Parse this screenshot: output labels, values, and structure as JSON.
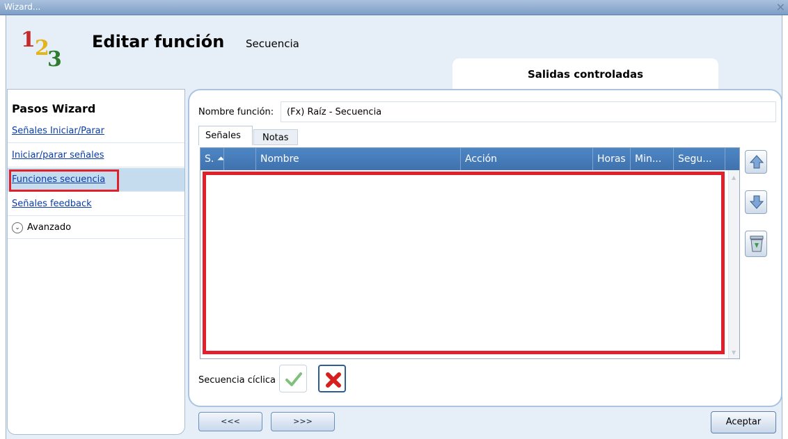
{
  "window": {
    "title": "Wizard...",
    "close_glyph": "✕"
  },
  "logo": {
    "digits": [
      "1",
      "2",
      "3"
    ]
  },
  "header": {
    "title": "Editar función",
    "subtitle": "Secuencia",
    "step_tab": "Salidas controladas"
  },
  "sidebar": {
    "heading": "Pasos Wizard",
    "items": [
      {
        "label": "Señales Iniciar/Parar",
        "selected": false
      },
      {
        "label": "Iniciar/parar señales",
        "selected": false
      },
      {
        "label": "Funciones secuencia",
        "selected": true
      },
      {
        "label": "Señales feedback",
        "selected": false
      }
    ],
    "advanced": {
      "label": "Avanzado",
      "icon": "chevron-down-circle-icon"
    }
  },
  "form": {
    "name_label": "Nombre función:",
    "name_value": "(Fx) Raíz - Secuencia",
    "tabs": [
      "Señales",
      "Notas"
    ],
    "active_tab": "Señales"
  },
  "grid": {
    "columns": [
      "S. ⏶",
      "",
      "Nombre",
      "Acción",
      "Horas",
      "Min...",
      "Segu..."
    ],
    "rows": []
  },
  "side_buttons": [
    "move-up-icon",
    "move-down-icon",
    "recycle-bin-icon"
  ],
  "cyclic": {
    "label": "Secuencia cíclica",
    "yes_icon": "check-icon",
    "no_icon": "x-icon"
  },
  "nav": {
    "prev": "<<<",
    "next": ">>>",
    "accept": "Aceptar"
  },
  "colors": {
    "highlight": "#e0202a",
    "grid_header": "#4d86c4",
    "link": "#0a3da8"
  }
}
